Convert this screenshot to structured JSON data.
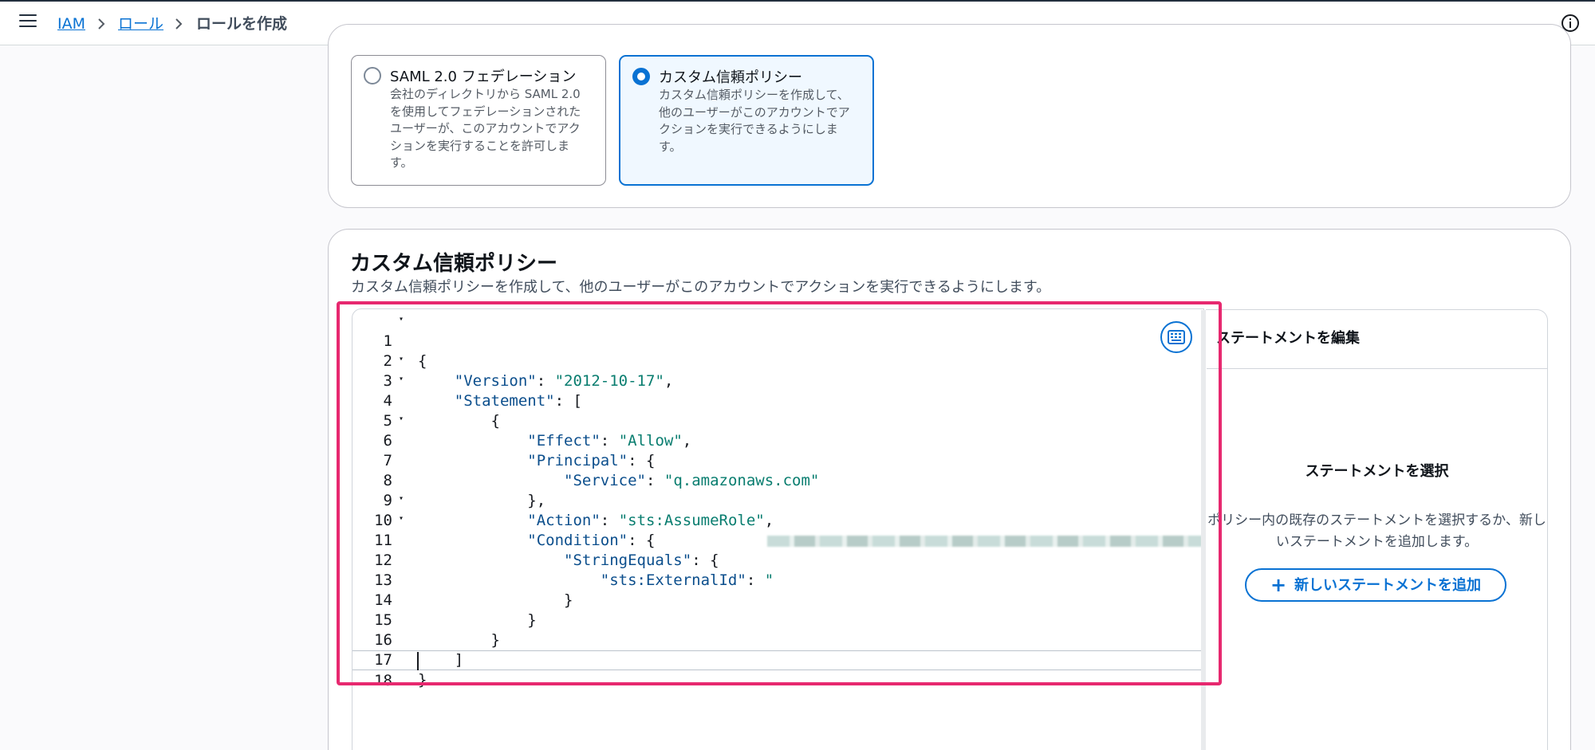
{
  "breadcrumb": {
    "items": [
      "IAM",
      "ロール"
    ],
    "current": "ロールを作成"
  },
  "trust_entity": {
    "options": [
      {
        "title": "SAML 2.0 フェデレーション",
        "description": "会社のディレクトリから SAML 2.0 を使用してフェデレーションされたユーザーが、このアカウントでアクションを実行することを許可します。",
        "selected": false
      },
      {
        "title": "カスタム信頼ポリシー",
        "description": "カスタム信頼ポリシーを作成して、他のユーザーがこのアカウントでアクションを実行できるようにします。",
        "selected": true
      }
    ]
  },
  "policy_section": {
    "title": "カスタム信頼ポリシー",
    "description": "カスタム信頼ポリシーを作成して、他のユーザーがこのアカウントでアクションを実行できるようにします。"
  },
  "editor": {
    "lines": [
      {
        "n": "1",
        "fold": "▾"
      },
      {
        "n": "2",
        "fold": ""
      },
      {
        "n": "3",
        "fold": "▾"
      },
      {
        "n": "4",
        "fold": "▾"
      },
      {
        "n": "5",
        "fold": ""
      },
      {
        "n": "6",
        "fold": "▾"
      },
      {
        "n": "7",
        "fold": ""
      },
      {
        "n": "8",
        "fold": ""
      },
      {
        "n": "9",
        "fold": ""
      },
      {
        "n": "10",
        "fold": "▾"
      },
      {
        "n": "11",
        "fold": "▾"
      },
      {
        "n": "12",
        "fold": ""
      },
      {
        "n": "13",
        "fold": ""
      },
      {
        "n": "14",
        "fold": ""
      },
      {
        "n": "15",
        "fold": ""
      },
      {
        "n": "16",
        "fold": ""
      },
      {
        "n": "17",
        "fold": ""
      },
      {
        "n": "18",
        "fold": ""
      }
    ],
    "tokens": {
      "open_brace": "{",
      "close_brace": "}",
      "close_brace_comma": "},",
      "close_bracket": "]",
      "colon_space": ": ",
      "comma": ",",
      "open_bracket_after": ": [",
      "open_brace_after": ": {",
      "quote": "\"",
      "version_key": "\"Version\"",
      "version_val": "\"2012-10-17\"",
      "statement_key": "\"Statement\"",
      "effect_key": "\"Effect\"",
      "effect_val": "\"Allow\"",
      "principal_key": "\"Principal\"",
      "service_key": "\"Service\"",
      "service_val": "\"q.amazonaws.com\"",
      "action_key": "\"Action\"",
      "action_val": "\"sts:AssumeRole\"",
      "condition_key": "\"Condition\"",
      "string_equals_key": "\"StringEquals\"",
      "external_id_key": "\"sts:ExternalId\""
    }
  },
  "right_panel": {
    "header": "ステートメントを編集",
    "title": "ステートメントを選択",
    "description": "ポリシー内の既存のステートメントを選択するか、新しいステートメントを追加します。",
    "add_button": "新しいステートメントを追加"
  },
  "icons": {
    "menu": "hamburger-menu-icon",
    "separator": "chevron-right-icon",
    "info": "info-icon",
    "keyboard": "keyboard-icon",
    "plus": "plus-icon"
  },
  "colors": {
    "accent": "#0972d3",
    "highlight": "#e7286f",
    "json_key": "#0b4e8c",
    "json_string": "#087d6f"
  }
}
